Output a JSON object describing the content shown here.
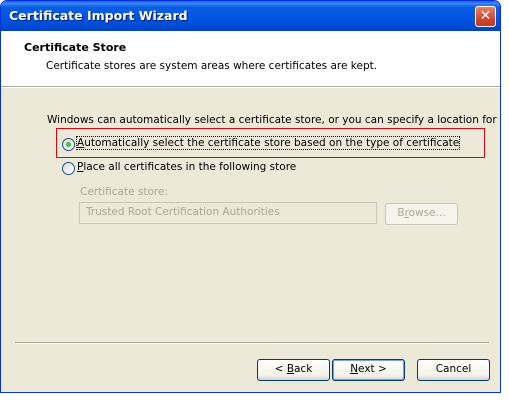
{
  "window": {
    "title": "Certificate Import Wizard",
    "close_glyph": "✕"
  },
  "header": {
    "title": "Certificate Store",
    "subtitle": "Certificate stores are system areas where certificates are kept."
  },
  "body": {
    "intro": "Windows can automatically select a certificate store, or you can specify a location for",
    "option_auto": {
      "accel": "A",
      "rest": "utomatically select the certificate store based on the type of certificate",
      "selected": true
    },
    "option_place": {
      "accel": "P",
      "rest": "lace all certificates in the following store",
      "selected": false
    },
    "store_label": "Certificate store:",
    "store_value": "Trusted Root Certification Authorities",
    "browse": {
      "accel": "r",
      "pre": "B",
      "post": "owse..."
    }
  },
  "footer": {
    "back": {
      "pre": "< ",
      "accel": "B",
      "post": "ack"
    },
    "next": {
      "accel": "N",
      "post": "ext >"
    },
    "cancel": "Cancel"
  },
  "colors": {
    "title_bar": "#0054e3",
    "highlight_border": "#e0000e",
    "dialog_bg": "#ece9d8"
  }
}
